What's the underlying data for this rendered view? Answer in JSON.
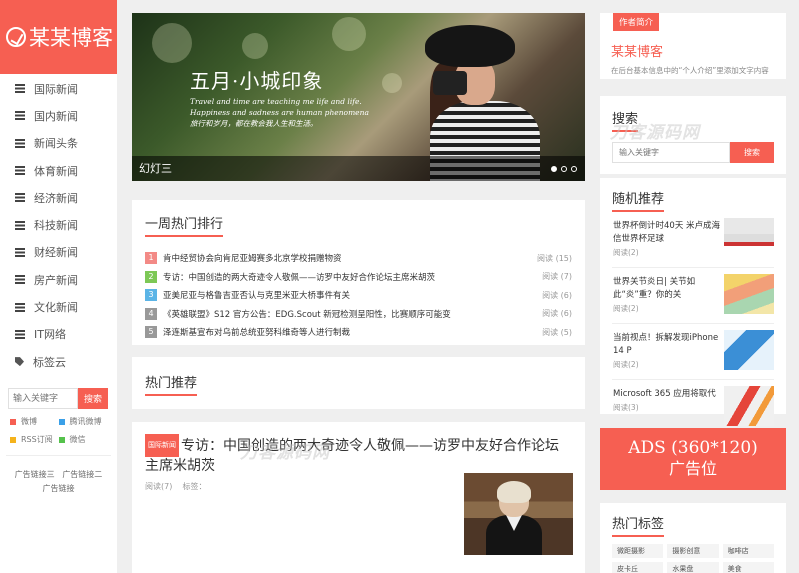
{
  "brand": {
    "logo_text": "某某博客",
    "accent": "#f65f52"
  },
  "sidebar": {
    "nav": [
      {
        "label": "国际新闻",
        "icon": "list-icon"
      },
      {
        "label": "国内新闻",
        "icon": "list-icon"
      },
      {
        "label": "新闻头条",
        "icon": "list-icon"
      },
      {
        "label": "体育新闻",
        "icon": "list-icon"
      },
      {
        "label": "经济新闻",
        "icon": "list-icon"
      },
      {
        "label": "科技新闻",
        "icon": "list-icon"
      },
      {
        "label": "财经新闻",
        "icon": "list-icon"
      },
      {
        "label": "房产新闻",
        "icon": "list-icon"
      },
      {
        "label": "文化新闻",
        "icon": "list-icon"
      },
      {
        "label": "IT网络",
        "icon": "list-icon"
      },
      {
        "label": "标签云",
        "icon": "tag-icon"
      }
    ],
    "search": {
      "placeholder": "输入关键字",
      "button": "搜索"
    },
    "social": [
      {
        "label": "微博",
        "color": "#f65f52"
      },
      {
        "label": "腾讯微博",
        "color": "#3aa0e8"
      },
      {
        "label": "RSS订阅",
        "color": "#f5b31c"
      },
      {
        "label": "微信",
        "color": "#55c24c"
      }
    ],
    "ad_links": [
      "广告链接三",
      "广告链接二",
      "广告链接"
    ]
  },
  "slider": {
    "title": "五月·小城印象",
    "subtitle_lines": [
      "Travel and time are teaching me life and life.",
      "Happiness and sadness are human phenomena",
      "旅行和岁月，都在教会我人生和生活。"
    ],
    "caption": "幻灯三"
  },
  "hot": {
    "title": "一周热门排行",
    "items": [
      {
        "rank": "1",
        "color": "#f38a86",
        "title": "肯中经贸协会向肯尼亚姆赛多北京学校捐赠物资",
        "reads": "阅读 (15)"
      },
      {
        "rank": "2",
        "color": "#7dc856",
        "title": "专访：中国创造的两大奇迹令人敬佩——访罗中友好合作论坛主席米胡茨",
        "reads": "阅读 (7)"
      },
      {
        "rank": "3",
        "color": "#5bb4e6",
        "title": "亚美尼亚与格鲁吉亚否认与克里米亚大桥事件有关",
        "reads": "阅读 (6)"
      },
      {
        "rank": "4",
        "color": "#999999",
        "title": "《英雄联盟》S12 官方公告：EDG.Scout 新冠检测呈阳性，比赛顺序可能变",
        "reads": "阅读 (6)"
      },
      {
        "rank": "5",
        "color": "#999999",
        "title": "泽连斯基宣布对乌前总统亚努科维奇等人进行制裁",
        "reads": "阅读 (5)"
      }
    ]
  },
  "recommend": {
    "title": "热门推荐"
  },
  "post": {
    "category": "国际新闻",
    "title": "专访：中国创造的两大奇迹令人敬佩——访罗中友好合作论坛主席米胡茨",
    "reads": "阅读(7)",
    "tags_label": "标签："
  },
  "author": {
    "tag": "作者简介",
    "name": "某某博客",
    "desc": "在后台基本信息中的“个人介绍”里添加文字内容"
  },
  "right_search": {
    "title": "搜索",
    "placeholder": "输入关键字",
    "button": "搜索"
  },
  "random": {
    "title": "随机推荐",
    "items": [
      {
        "title": "世界杯倒计时40天 米卢成海信世界杯足球",
        "reads": "阅读(2)"
      },
      {
        "title": "世界关节炎日| 关节如此“炎”重？你的关",
        "reads": "阅读(2)"
      },
      {
        "title": "当前视点！拆解发现iPhone 14 P",
        "reads": "阅读(2)"
      },
      {
        "title": "Microsoft 365 应用将取代",
        "reads": "阅读(3)"
      }
    ]
  },
  "ads": {
    "line1": "ADS (360*120)",
    "line2": "广告位"
  },
  "tags": {
    "title": "热门标签",
    "items": [
      "微距摄影",
      "摄影创意",
      "咖啡店",
      "皮卡丘",
      "水果盘",
      "美食"
    ]
  },
  "watermark": "刀客源码网"
}
